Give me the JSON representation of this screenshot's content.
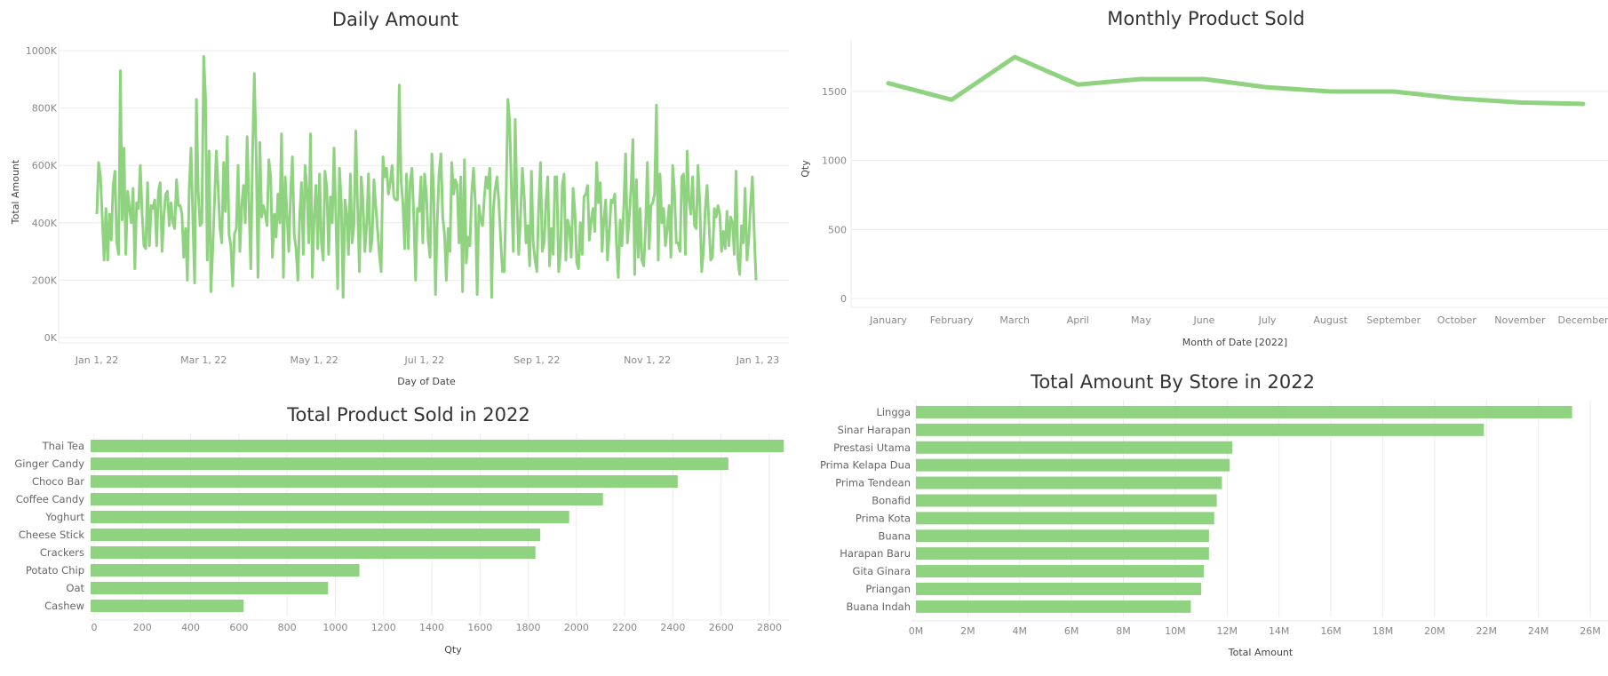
{
  "colors": {
    "series": "#8fd27f",
    "grid": "#ececec",
    "axis_text": "#888888"
  },
  "chart_data": [
    {
      "type": "line",
      "title": "Daily Amount",
      "xlabel": "Day of Date",
      "ylabel": "Total Amount",
      "x_start": "2022-01-01",
      "x_ticks": [
        "Jan 1, 22",
        "Mar 1, 22",
        "May 1, 22",
        "Jul 1, 22",
        "Sep 1, 22",
        "Nov 1, 22",
        "Jan 1, 23"
      ],
      "x_tick_days": [
        0,
        59,
        120,
        181,
        243,
        304,
        365
      ],
      "y_ticks": [
        "0K",
        "200K",
        "400K",
        "600K",
        "800K",
        "1000K"
      ],
      "y_tick_values": [
        0,
        200000,
        400000,
        600000,
        800000,
        1000000
      ],
      "ylim": [
        0,
        1000000
      ],
      "grid": true,
      "series": [
        {
          "x_days": [
            0,
            1,
            2,
            4,
            5,
            6,
            7,
            8,
            9,
            10,
            11,
            12,
            13,
            14,
            15,
            16,
            17,
            18,
            19,
            20,
            21,
            22,
            23,
            24,
            25,
            26,
            27,
            28,
            29,
            30,
            31,
            32,
            33,
            34,
            35,
            36,
            37,
            38,
            39,
            40,
            41,
            42,
            43,
            44,
            45,
            46,
            47,
            48,
            49,
            50,
            51,
            52,
            53,
            54,
            55,
            56,
            57,
            58,
            59,
            60,
            61,
            62,
            63,
            64,
            65,
            66,
            67,
            68,
            69,
            70,
            71,
            72,
            73,
            74,
            75,
            76,
            77,
            78,
            79,
            80,
            81,
            82,
            83,
            84,
            85,
            86,
            87,
            88,
            89,
            90,
            91,
            92,
            93,
            94,
            95,
            96,
            97,
            98,
            99,
            100,
            101,
            102,
            103,
            104,
            105,
            106,
            107,
            108,
            109,
            110,
            111,
            112,
            113,
            114,
            115,
            116,
            117,
            118,
            119,
            120,
            121,
            122,
            123,
            124,
            125,
            126,
            127,
            128,
            129,
            130,
            131,
            132,
            133,
            134,
            135,
            136,
            137,
            138,
            139,
            140,
            141,
            142,
            143,
            144,
            145,
            146,
            147,
            148,
            149,
            150,
            151,
            152,
            153,
            154,
            155,
            156,
            157,
            158,
            159,
            160,
            161,
            162,
            163,
            164,
            165,
            166,
            167,
            168,
            169,
            170,
            171,
            172,
            173,
            174,
            175,
            176,
            177,
            178,
            179,
            180,
            181,
            182,
            183,
            184,
            185,
            186,
            187,
            188,
            189,
            190,
            191,
            192,
            193,
            194,
            195,
            196,
            197,
            198,
            199,
            200,
            201,
            202,
            203,
            204,
            205,
            206,
            207,
            208,
            209,
            210,
            211,
            212,
            213,
            214,
            215,
            216,
            217,
            218,
            219,
            220,
            221,
            222,
            223,
            224,
            225,
            226,
            227,
            228,
            229,
            230,
            231,
            232,
            233,
            234,
            235,
            236,
            237,
            238,
            239,
            240,
            241,
            242,
            243,
            244,
            245,
            246,
            247,
            248,
            249,
            250,
            251,
            252,
            253,
            254,
            255,
            256,
            257,
            258,
            259,
            260,
            261,
            262,
            263,
            264,
            265,
            266,
            267,
            268,
            269,
            270,
            271,
            272,
            273,
            274,
            275,
            276,
            277,
            278,
            279,
            280,
            281,
            282,
            283,
            284,
            285,
            286,
            287,
            288,
            289,
            290,
            291,
            292,
            293,
            294,
            295,
            296,
            297,
            298,
            299,
            300,
            301,
            302,
            303,
            304,
            305,
            306,
            307,
            308,
            309,
            310,
            311,
            312,
            313,
            314,
            315,
            316,
            317,
            318,
            319,
            320,
            321,
            322,
            323,
            324,
            325,
            326,
            327,
            328,
            329,
            330,
            331,
            332,
            333,
            334,
            335,
            336,
            337,
            338,
            339,
            340,
            341,
            342,
            343,
            344,
            345,
            346,
            347,
            348,
            349,
            350,
            351,
            352,
            353,
            354,
            355,
            356,
            357,
            358,
            359,
            360,
            361,
            362,
            363,
            364
          ],
          "values": [
            430000,
            610000,
            560000,
            270000,
            450000,
            270000,
            430000,
            340000,
            530000,
            580000,
            330000,
            290000,
            930000,
            410000,
            660000,
            290000,
            510000,
            450000,
            400000,
            520000,
            240000,
            470000,
            450000,
            600000,
            430000,
            320000,
            310000,
            540000,
            320000,
            460000,
            450000,
            480000,
            320000,
            510000,
            540000,
            300000,
            420000,
            500000,
            510000,
            390000,
            470000,
            400000,
            380000,
            550000,
            460000,
            460000,
            430000,
            280000,
            380000,
            200000,
            520000,
            660000,
            420000,
            190000,
            830000,
            510000,
            390000,
            400000,
            980000,
            840000,
            270000,
            650000,
            160000,
            310000,
            480000,
            650000,
            520000,
            380000,
            330000,
            610000,
            440000,
            700000,
            360000,
            320000,
            180000,
            360000,
            380000,
            600000,
            300000,
            460000,
            530000,
            400000,
            700000,
            470000,
            240000,
            650000,
            920000,
            630000,
            210000,
            680000,
            420000,
            460000,
            430000,
            390000,
            620000,
            560000,
            280000,
            430000,
            350000,
            500000,
            400000,
            710000,
            210000,
            560000,
            430000,
            300000,
            500000,
            630000,
            360000,
            310000,
            200000,
            420000,
            540000,
            290000,
            600000,
            520000,
            330000,
            710000,
            210000,
            420000,
            530000,
            310000,
            570000,
            330000,
            270000,
            580000,
            520000,
            290000,
            490000,
            400000,
            660000,
            410000,
            170000,
            590000,
            470000,
            140000,
            480000,
            430000,
            290000,
            570000,
            330000,
            390000,
            720000,
            460000,
            230000,
            560000,
            470000,
            300000,
            390000,
            570000,
            300000,
            340000,
            550000,
            460000,
            380000,
            290000,
            230000,
            630000,
            560000,
            590000,
            500000,
            540000,
            600000,
            490000,
            480000,
            480000,
            880000,
            550000,
            470000,
            310000,
            570000,
            310000,
            540000,
            590000,
            430000,
            200000,
            450000,
            440000,
            560000,
            330000,
            570000,
            500000,
            340000,
            280000,
            640000,
            510000,
            150000,
            410000,
            570000,
            640000,
            420000,
            360000,
            200000,
            380000,
            300000,
            610000,
            500000,
            550000,
            530000,
            330000,
            560000,
            160000,
            620000,
            260000,
            350000,
            320000,
            500000,
            590000,
            470000,
            150000,
            460000,
            410000,
            390000,
            490000,
            560000,
            520000,
            590000,
            140000,
            450000,
            520000,
            560000,
            470000,
            340000,
            230000,
            230000,
            490000,
            830000,
            750000,
            500000,
            300000,
            760000,
            470000,
            290000,
            430000,
            590000,
            490000,
            330000,
            390000,
            250000,
            580000,
            330000,
            270000,
            230000,
            460000,
            610000,
            300000,
            330000,
            470000,
            560000,
            250000,
            380000,
            290000,
            560000,
            560000,
            230000,
            290000,
            530000,
            570000,
            270000,
            410000,
            380000,
            280000,
            520000,
            440000,
            260000,
            240000,
            400000,
            290000,
            490000,
            500000,
            530000,
            340000,
            410000,
            450000,
            370000,
            610000,
            470000,
            540000,
            300000,
            410000,
            480000,
            270000,
            370000,
            480000,
            470000,
            500000,
            320000,
            210000,
            410000,
            320000,
            460000,
            640000,
            330000,
            420000,
            520000,
            690000,
            220000,
            550000,
            280000,
            450000,
            270000,
            250000,
            380000,
            610000,
            310000,
            460000,
            470000,
            500000,
            810000,
            270000,
            570000,
            400000,
            450000,
            320000,
            380000,
            460000,
            280000,
            600000,
            510000,
            330000,
            330000,
            300000,
            560000,
            570000,
            290000,
            650000,
            480000,
            430000,
            560000,
            390000,
            380000,
            600000,
            460000,
            230000,
            300000,
            450000,
            530000,
            400000,
            270000,
            280000,
            450000,
            420000,
            460000,
            430000,
            300000,
            370000,
            310000,
            440000,
            320000,
            420000,
            400000,
            290000,
            580000,
            270000,
            220000,
            390000,
            330000,
            520000,
            270000,
            340000,
            460000,
            560000,
            370000,
            200000,
            650000,
            380000,
            330000,
            520000,
            640000,
            620000,
            510000,
            450000,
            370000,
            370000
          ]
        }
      ]
    },
    {
      "type": "line",
      "title": "Monthly Product Sold",
      "xlabel": "Month of Date [2022]",
      "ylabel": "Qty",
      "categories": [
        "January",
        "February",
        "March",
        "April",
        "May",
        "June",
        "July",
        "August",
        "September",
        "October",
        "November",
        "December"
      ],
      "y_ticks": [
        "0",
        "500",
        "1000",
        "1500"
      ],
      "y_tick_values": [
        0,
        500,
        1000,
        1500
      ],
      "ylim": [
        0,
        1800
      ],
      "grid": true,
      "series": [
        {
          "values": [
            1560,
            1440,
            1750,
            1550,
            1590,
            1590,
            1530,
            1500,
            1500,
            1450,
            1420,
            1410
          ]
        }
      ]
    },
    {
      "type": "bar",
      "orientation": "horizontal",
      "title": "Total Product Sold in 2022",
      "xlabel": "Qty",
      "categories": [
        "Thai Tea",
        "Ginger Candy",
        "Choco Bar",
        "Coffee Candy",
        "Yoghurt",
        "Cheese Stick",
        "Crackers",
        "Potato Chip",
        "Oat",
        "Cashew"
      ],
      "values": [
        2860,
        2630,
        2420,
        2110,
        1970,
        1850,
        1830,
        1100,
        970,
        620
      ],
      "x_ticks": [
        "0",
        "200",
        "400",
        "600",
        "800",
        "1000",
        "1200",
        "1400",
        "1600",
        "1800",
        "2000",
        "2200",
        "2400",
        "2600",
        "2800"
      ],
      "x_tick_values": [
        0,
        200,
        400,
        600,
        800,
        1000,
        1200,
        1400,
        1600,
        1800,
        2000,
        2200,
        2400,
        2600,
        2800
      ],
      "xlim": [
        0,
        2950
      ],
      "grid": true
    },
    {
      "type": "bar",
      "orientation": "horizontal",
      "title": "Total Amount By Store in 2022",
      "xlabel": "Total Amount",
      "categories": [
        "Lingga",
        "Sinar Harapan",
        "Prestasi Utama",
        "Prima Kelapa Dua",
        "Prima Tendean",
        "Bonafid",
        "Prima Kota",
        "Buana",
        "Harapan Baru",
        "Gita Ginara",
        "Priangan",
        "Buana Indah"
      ],
      "values": [
        25300000,
        21900000,
        12200000,
        12100000,
        11800000,
        11600000,
        11500000,
        11300000,
        11300000,
        11100000,
        11000000,
        10600000
      ],
      "x_ticks": [
        "0M",
        "2M",
        "4M",
        "6M",
        "8M",
        "10M",
        "12M",
        "14M",
        "16M",
        "18M",
        "20M",
        "22M",
        "24M",
        "26M"
      ],
      "x_tick_values": [
        0,
        2000000,
        4000000,
        6000000,
        8000000,
        10000000,
        12000000,
        14000000,
        16000000,
        18000000,
        20000000,
        22000000,
        24000000,
        26000000
      ],
      "xlim": [
        0,
        26000000
      ],
      "grid": true
    }
  ]
}
